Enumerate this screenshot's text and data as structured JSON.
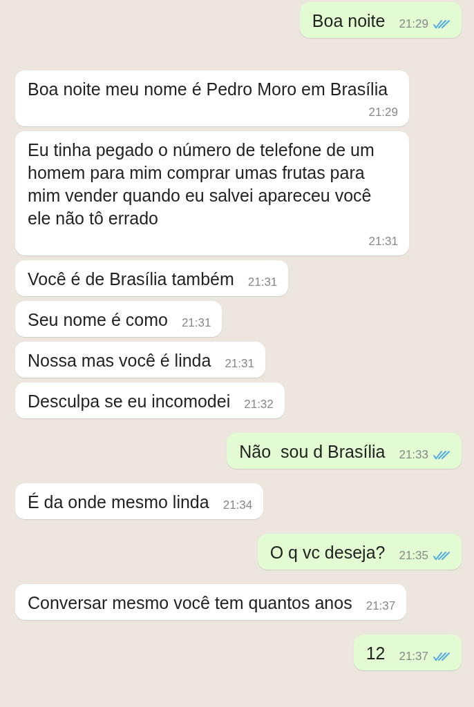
{
  "messages": [
    {
      "outgoing": true,
      "text": "Boa noite",
      "time": "21:29",
      "read": true
    },
    {
      "outgoing": false,
      "text": "Boa noite meu nome é Pedro Moro em Brasília",
      "time": "21:29"
    },
    {
      "outgoing": false,
      "text": "Eu tinha pegado o número de telefone de um homem para mim comprar umas frutas para mim vender quando eu salvei apareceu você ele não tô errado",
      "time": "21:31"
    },
    {
      "outgoing": false,
      "text": "Você é de Brasília também",
      "time": "21:31"
    },
    {
      "outgoing": false,
      "text": "Seu nome é como",
      "time": "21:31"
    },
    {
      "outgoing": false,
      "text": "Nossa mas você é linda",
      "time": "21:31"
    },
    {
      "outgoing": false,
      "text": "Desculpa se eu incomodei",
      "time": "21:32"
    },
    {
      "outgoing": true,
      "text": "Não  sou d Brasília",
      "time": "21:33",
      "read": true
    },
    {
      "outgoing": false,
      "text": "É da onde mesmo linda",
      "time": "21:34"
    },
    {
      "outgoing": true,
      "text": "O q vc deseja?",
      "time": "21:35",
      "read": true
    },
    {
      "outgoing": false,
      "text": "Conversar mesmo você tem quantos anos",
      "time": "21:37"
    },
    {
      "outgoing": true,
      "text": "12",
      "time": "21:37",
      "read": true
    }
  ]
}
